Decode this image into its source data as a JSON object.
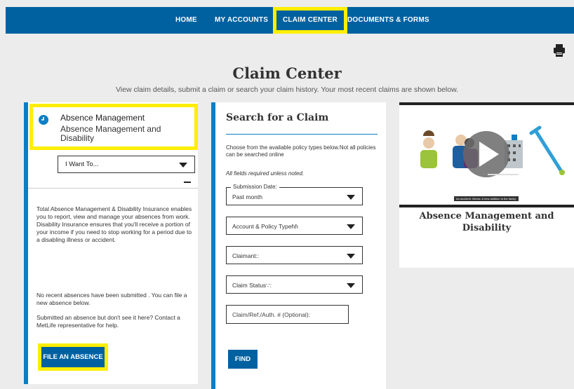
{
  "nav": {
    "items": [
      {
        "label": "HOME"
      },
      {
        "label": "MY ACCOUNTS"
      },
      {
        "label": "CLAIM CENTER",
        "active": true
      },
      {
        "label": "DOCUMENTS & FORMS"
      }
    ]
  },
  "page": {
    "title": "Claim Center",
    "subtitle": "View claim details, submit a claim or search your claim history. Your most recent claims are shown below."
  },
  "absence": {
    "title": "Absence Management",
    "subtitle": "Absence Management and Disability",
    "i_want_to": "I Want To...",
    "description": "Total Absence Management & Disability Insurance enables you to report, view and manage your absences from work. Disability Insurance ensures that you'll receive a portion of your income if you need to stop working for a period due to a disabling illness or accident.",
    "no_recent": "No recent absences have been submitted . You can file a new absence below.",
    "contact": "Submitted an absence but don't see it here? Contact a MetLife representative for help.",
    "file_button": "FILE AN ABSENCE"
  },
  "search": {
    "title": "Search for a Claim",
    "intro": "Choose from the available policy types below.Not all policies can be searched online",
    "required_note": "All fields required unless noted.",
    "submission_date_label": "Submission Date:",
    "submission_date_value": "Past month",
    "account_policy": "Account & Policy Typeɦɦ",
    "claimant": "Claimant::",
    "claim_status": "Claim Status∵:",
    "claim_ref_placeholder": "Claim/Ref./Auth. # (Optional):",
    "find_button": "FIND"
  },
  "video": {
    "caption": "An accident. Illness. A new addition to the family.",
    "title": "Absence Management and Disability"
  },
  "colors": {
    "nav_blue": "#0061a0",
    "highlight_yellow": "#ffee00",
    "card_accent": "#0a7fc5"
  }
}
